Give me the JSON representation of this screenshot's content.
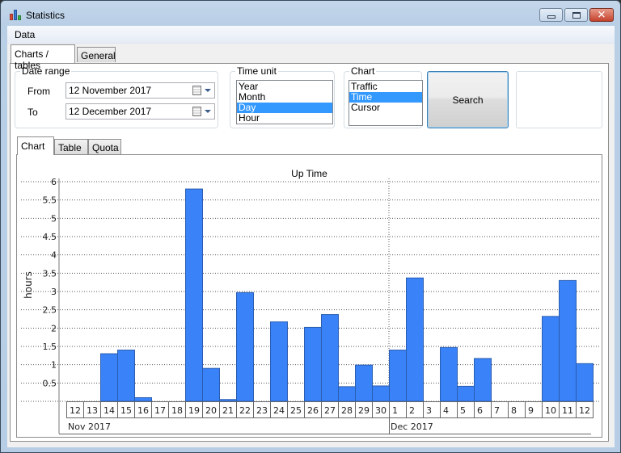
{
  "window": {
    "title": "Statistics",
    "controls": {
      "minimize": "minimize",
      "maximize": "maximize",
      "close": "close"
    }
  },
  "menu": {
    "items": [
      {
        "label": "Data"
      }
    ]
  },
  "main_tabs": [
    {
      "label": "Charts / tables",
      "active": true
    },
    {
      "label": "General",
      "active": false
    }
  ],
  "date_range": {
    "title": "Date range",
    "from_label": "From",
    "from_value": "12 November 2017",
    "to_label": "To",
    "to_value": "12 December 2017"
  },
  "time_unit": {
    "title": "Time unit",
    "options": [
      "Year",
      "Month",
      "Day",
      "Hour"
    ],
    "selected": "Day"
  },
  "chart_select": {
    "title": "Chart",
    "options": [
      "Traffic",
      "Time",
      "Cursor"
    ],
    "selected": "Time"
  },
  "search_button": {
    "label": "Search"
  },
  "sub_tabs": [
    {
      "label": "Chart",
      "active": true
    },
    {
      "label": "Table",
      "active": false
    },
    {
      "label": "Quota",
      "active": false
    }
  ],
  "colors": {
    "bar_fill": "#3a82f7",
    "bar_stroke": "#2a5db0",
    "selection": "#3399ff"
  },
  "chart_data": {
    "type": "bar",
    "title": "Up Time",
    "xlabel": "",
    "ylabel": "hours",
    "ylim": [
      0,
      6
    ],
    "yticks": [
      "0.5",
      "1",
      "1.5",
      "2",
      "2.5",
      "3",
      "3.5",
      "4",
      "4.5",
      "5",
      "5.5",
      "6"
    ],
    "ytick_values": [
      0.5,
      1,
      1.5,
      2,
      2.5,
      3,
      3.5,
      4,
      4.5,
      5,
      5.5,
      6
    ],
    "grid": true,
    "categories": [
      "12",
      "13",
      "14",
      "15",
      "16",
      "17",
      "18",
      "19",
      "20",
      "21",
      "22",
      "23",
      "24",
      "25",
      "26",
      "27",
      "28",
      "29",
      "30",
      "1",
      "2",
      "3",
      "4",
      "5",
      "6",
      "7",
      "8",
      "9",
      "10",
      "11",
      "12"
    ],
    "values": [
      0,
      0,
      1.3,
      1.4,
      0.1,
      0,
      0,
      5.8,
      0.9,
      0.05,
      2.97,
      0,
      2.17,
      0,
      2.02,
      2.37,
      0.4,
      0.99,
      0.42,
      1.4,
      3.37,
      0,
      1.47,
      0.41,
      1.17,
      0,
      0,
      0,
      2.32,
      3.3,
      1.03
    ],
    "month_groups": [
      {
        "label": "Nov 2017",
        "count": 19
      },
      {
        "label": "Dec 2017",
        "count": 12
      }
    ]
  }
}
